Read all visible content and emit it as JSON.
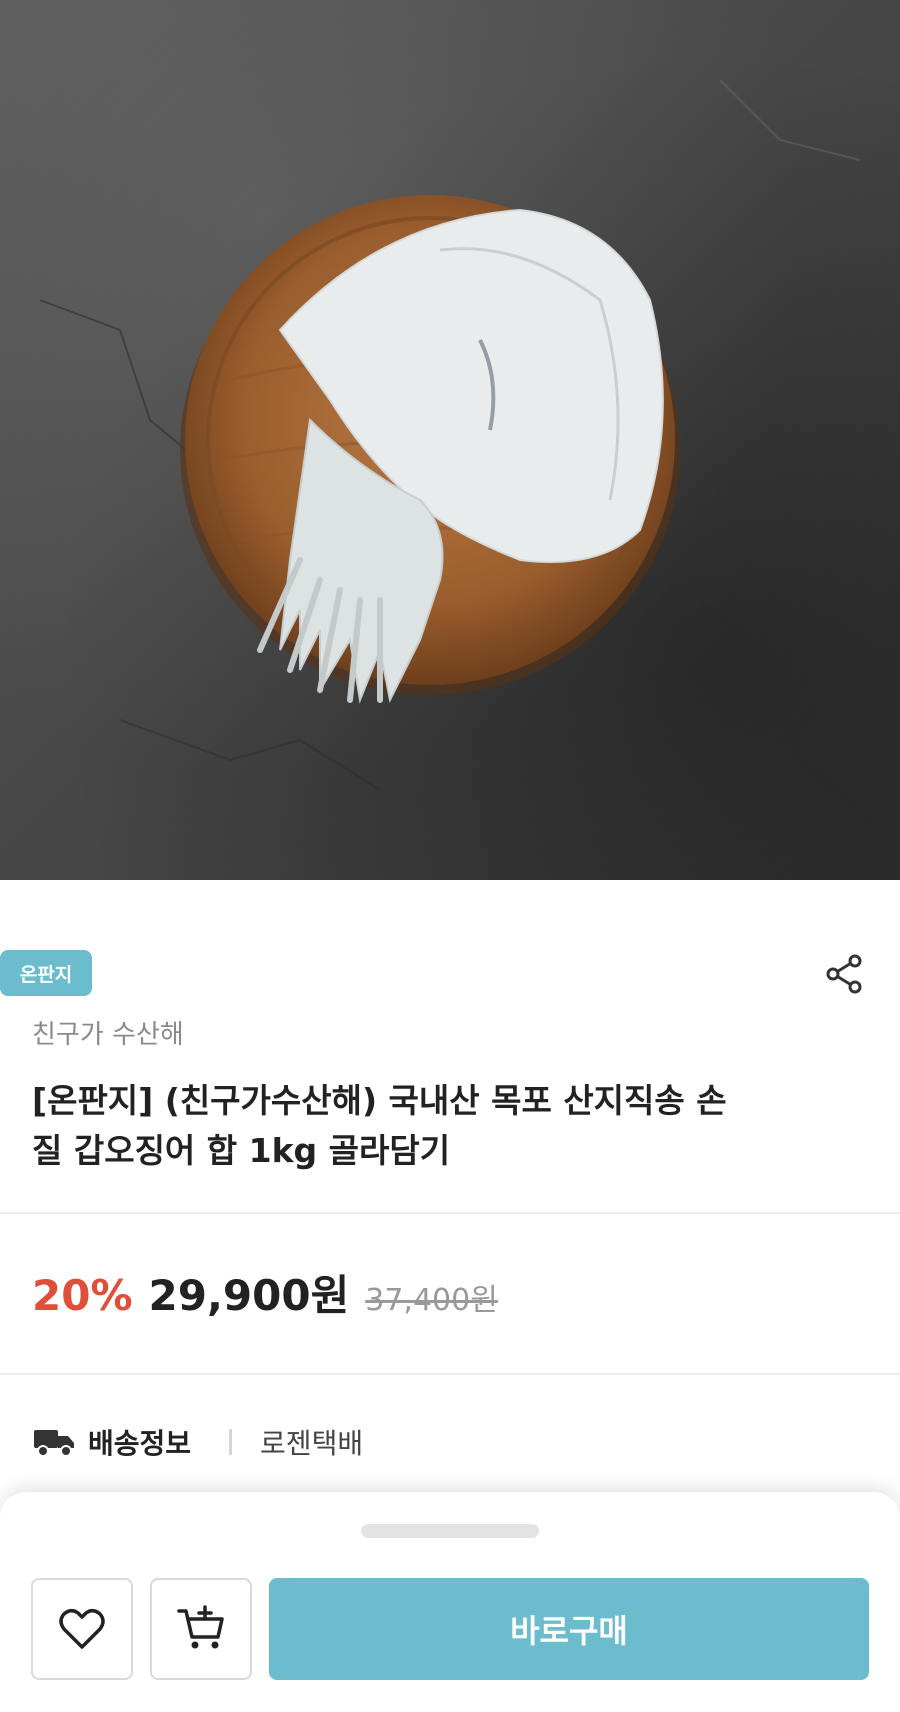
{
  "product": {
    "badge": "온판지",
    "seller": "친구가 수산해",
    "title": "[온판지] (친구가수산해) 국내산 목포 산지직송 손질 갑오징어 합 1kg 골라담기",
    "image_alt": "손질 갑오징어 on wooden plate"
  },
  "pricing": {
    "discount": "20%",
    "price": "29,900원",
    "original_price": "37,400원"
  },
  "shipping": {
    "label": "배송정보",
    "value": "로젠택배"
  },
  "actions": {
    "buy_label": "바로구매"
  },
  "icons": {
    "share": "share-icon",
    "truck": "truck-icon",
    "like": "heart-icon",
    "cart": "cart-plus-icon"
  },
  "colors": {
    "accent": "#6bbccc",
    "discount": "#e04f3a"
  }
}
